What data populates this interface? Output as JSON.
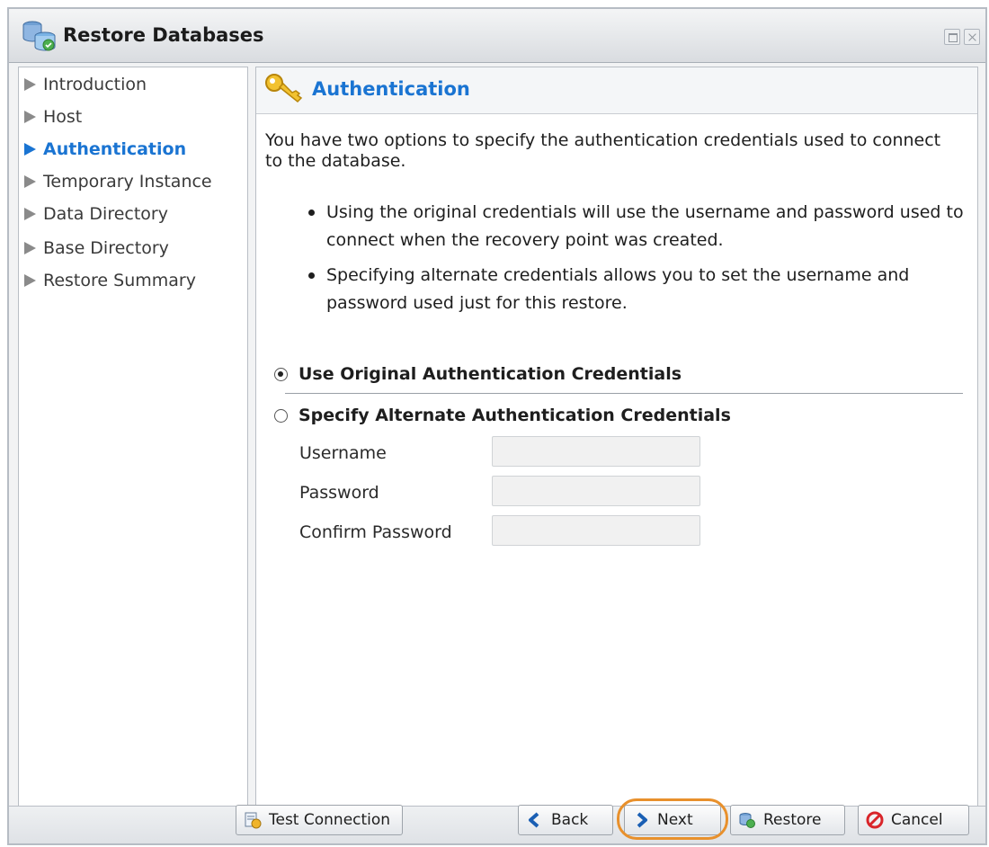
{
  "window": {
    "title": "Restore Databases"
  },
  "sidebar": {
    "items": [
      {
        "label": "Introduction",
        "active": false
      },
      {
        "label": "Host",
        "active": false
      },
      {
        "label": "Authentication",
        "active": true
      },
      {
        "label": "Temporary Instance",
        "active": false
      },
      {
        "label": "Data Directory",
        "active": false
      },
      {
        "label": "Base Directory",
        "active": false
      },
      {
        "label": "Restore Summary",
        "active": false
      }
    ]
  },
  "main": {
    "title": "Authentication",
    "intro": "You have two options to specify the authentication credentials used to connect to the database.",
    "bullets": [
      "Using the original credentials will use the username and password used to connect when the recovery point was created.",
      "Specifying alternate credentials allows you to set the username and password used just for this restore."
    ],
    "options": {
      "original": {
        "label": "Use Original Authentication Credentials",
        "selected": true
      },
      "alternate": {
        "label": "Specify Alternate Authentication Credentials",
        "selected": false
      }
    },
    "fields": {
      "username": {
        "label": "Username",
        "value": ""
      },
      "password": {
        "label": "Password",
        "value": ""
      },
      "confirm": {
        "label": "Confirm Password",
        "value": ""
      }
    }
  },
  "footer": {
    "test_connection": "Test Connection",
    "back": "Back",
    "next": "Next",
    "restore": "Restore",
    "cancel": "Cancel"
  },
  "colors": {
    "accent": "#1a74d2",
    "highlight": "#e8902c",
    "cancel_icon": "#d9252a"
  }
}
